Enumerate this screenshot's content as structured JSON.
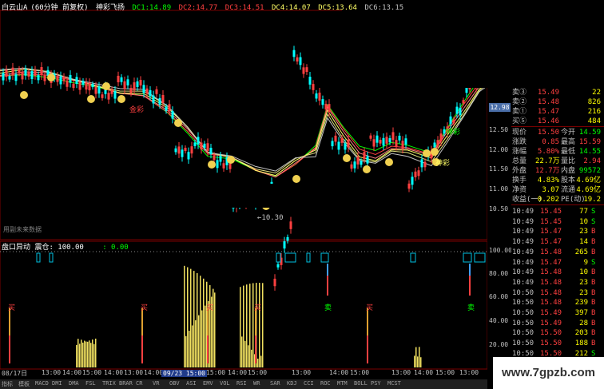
{
  "legend": {
    "title": "白云山A",
    "period": "(60分钟 前复权)",
    "indicator": "神彩飞扬",
    "dc": [
      {
        "label": "DC1:14.89",
        "color": "#00ff00"
      },
      {
        "label": "DC2:14.77",
        "color": "#ff4040"
      },
      {
        "label": "DC3:14.51",
        "color": "#ff4040"
      },
      {
        "label": "DC4:14.07",
        "color": "#ffff66"
      },
      {
        "label": "DC5:13.64",
        "color": "#ffff66"
      },
      {
        "label": "DC6:13.15",
        "color": "#c0c0c0"
      }
    ]
  },
  "price_axis": [
    "12.98",
    "12.50",
    "12.00",
    "11.50",
    "11.00",
    "10.50"
  ],
  "sub_axis": [
    "100.00",
    "80.00",
    "60.00",
    "40.00",
    "20.00"
  ],
  "current_price_tag": "12.98",
  "low_label": "←10.30",
  "qs_label": "用副未来数据",
  "annotations": [
    {
      "text": "金彩",
      "color": "#ff4040"
    },
    {
      "text": "神彩",
      "color": "#ffff66"
    },
    {
      "text": "神彩",
      "color": "#00ff00"
    }
  ],
  "sub_legend": {
    "name": "盘口异动",
    "value": "震仓: 100.00",
    "value2": ": 0.00"
  },
  "signals": [
    {
      "text": "买",
      "color": "#ff4040"
    },
    {
      "text": "买",
      "color": "#ff4040"
    },
    {
      "text": "买",
      "color": "#ff4040"
    },
    {
      "text": "买",
      "color": "#ff4040"
    },
    {
      "text": "卖",
      "color": "#00ff00"
    },
    {
      "text": "买",
      "color": "#ff4040"
    },
    {
      "text": "卖",
      "color": "#00ff00"
    }
  ],
  "time_axis": [
    "08/17日",
    "13:00",
    "14:00",
    "15:00",
    "14:00",
    "13:00",
    "14:00",
    "15:00",
    "14:00",
    "15:00",
    "13:00",
    "14:00",
    "15:00",
    "13:00",
    "14:00",
    "15:00",
    "13:00"
  ],
  "cursor_time": "09/23 15:00",
  "tabs": [
    "指标",
    "模板",
    "MACD",
    "DMI",
    "DMA",
    "FSL",
    "TRIX",
    "BRAR",
    "CR",
    "VR",
    "OBV",
    "ASI",
    "EMV",
    "VOL",
    "RSI",
    "WR",
    "SAR",
    "KDJ",
    "CCI",
    "ROC",
    "MTM",
    "BOLL",
    "PSY",
    "MCST"
  ],
  "quote_panel": {
    "asks": [
      {
        "label": "卖③",
        "price": "15.49",
        "vol": "22"
      },
      {
        "label": "卖②",
        "price": "15.48",
        "vol": "826"
      },
      {
        "label": "卖①",
        "price": "15.47",
        "vol": "216"
      },
      {
        "label": "买⑤",
        "price": "15.46",
        "vol": "484"
      }
    ],
    "stats": [
      {
        "k1": "现价",
        "v1": "15.50",
        "k2": "今开",
        "v2": "14.59",
        "c1": "#ff4040",
        "c2": "#00ff00"
      },
      {
        "k1": "涨跌",
        "v1": "0.85",
        "k2": "最高",
        "v2": "15.59",
        "c1": "#ff4040",
        "c2": "#ff4040"
      },
      {
        "k1": "涨幅",
        "v1": "5.80%",
        "k2": "最低",
        "v2": "14.55",
        "c1": "#ff4040",
        "c2": "#00ff00"
      },
      {
        "k1": "总量",
        "v1": "22.7万",
        "k2": "量比",
        "v2": "2.94",
        "c1": "#ffff00",
        "c2": "#ff4040"
      },
      {
        "k1": "外盘",
        "v1": "12.7万",
        "k2": "内盘",
        "v2": "99572",
        "c1": "#ff4040",
        "c2": "#00ff00"
      },
      {
        "k1": "换手",
        "v1": "4.83%",
        "k2": "股本",
        "v2": "4.69亿",
        "c1": "#ffff00",
        "c2": "#ffff00"
      },
      {
        "k1": "净资",
        "v1": "3.07",
        "k2": "流通",
        "v2": "4.69亿",
        "c1": "#ffff00",
        "c2": "#ffff00"
      },
      {
        "k1": "收益(一)",
        "v1": "0.202",
        "k2": "PE(动)",
        "v2": "19.2",
        "c1": "#ffff00",
        "c2": "#ffff00"
      }
    ],
    "ticks": [
      {
        "t": "10:49",
        "p": "15.45",
        "v": "77",
        "s": "S"
      },
      {
        "t": "10:49",
        "p": "15.45",
        "v": "10",
        "s": "S"
      },
      {
        "t": "10:49",
        "p": "15.47",
        "v": "23",
        "s": "B"
      },
      {
        "t": "10:49",
        "p": "15.47",
        "v": "14",
        "s": "B"
      },
      {
        "t": "10:49",
        "p": "15.48",
        "v": "265",
        "s": "B"
      },
      {
        "t": "10:49",
        "p": "15.47",
        "v": "9",
        "s": "S"
      },
      {
        "t": "10:49",
        "p": "15.48",
        "v": "10",
        "s": "B"
      },
      {
        "t": "10:49",
        "p": "15.48",
        "v": "23",
        "s": "B"
      },
      {
        "t": "10:50",
        "p": "15.48",
        "v": "23",
        "s": "B"
      },
      {
        "t": "10:50",
        "p": "15.48",
        "v": "239",
        "s": "B"
      },
      {
        "t": "10:50",
        "p": "15.49",
        "v": "397",
        "s": "B"
      },
      {
        "t": "10:50",
        "p": "15.49",
        "v": "28",
        "s": "B"
      },
      {
        "t": "10:50",
        "p": "15.50",
        "v": "203",
        "s": "B"
      },
      {
        "t": "10:50",
        "p": "15.50",
        "v": "188",
        "s": "B"
      },
      {
        "t": "10:50",
        "p": "15.50",
        "v": "212",
        "s": "S"
      }
    ]
  },
  "watermark": "www.7gpzb.com"
}
